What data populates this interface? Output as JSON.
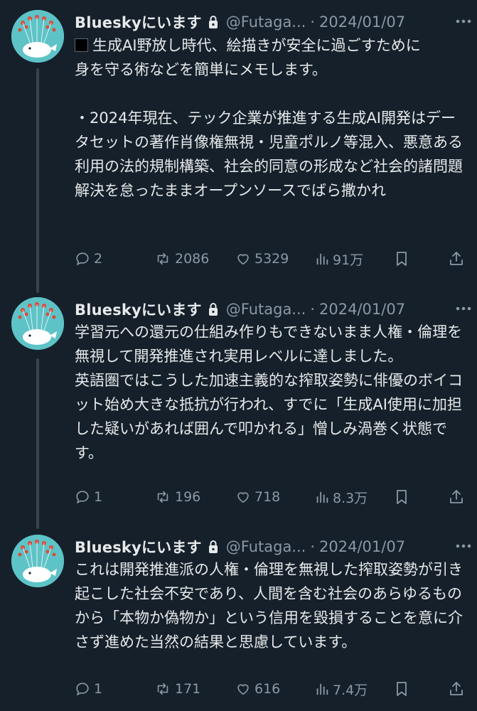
{
  "tweets": [
    {
      "display_name": "Blueskyにいます",
      "handle": "@Futaga...",
      "separator": "·",
      "date": "2024/01/07",
      "text_lead": "生成AI野放し時代、絵描きが安全に過ごすため",
      "text_rest": "に\n身を守る術などを簡単にメモします。\n\n・2024年現在、テック企業が推進する生成AI開発はデータセットの著作肖像権無視・児童ポルノ等混入、悪意ある利用の法的規制構築、社会的同意の形成など社会的諸問題解決を怠ったままオープンソースでばら撒かれ",
      "replies": "2",
      "reposts": "2086",
      "likes": "5329",
      "views": "91万"
    },
    {
      "display_name": "Blueskyにいます",
      "handle": "@Futaga...",
      "separator": "·",
      "date": "2024/01/07",
      "text": "学習元への還元の仕組み作りもできないまま人権・倫理を無視して開発推進され実用レベルに達しました。\n英語圏ではこうした加速主義的な搾取姿勢に俳優のボイコット始め大きな抵抗が行われ、すでに「生成AI使用に加担した疑いがあれば囲んで叩かれる」憎しみ渦巻く状態です。",
      "replies": "1",
      "reposts": "196",
      "likes": "718",
      "views": "8.3万"
    },
    {
      "display_name": "Blueskyにいます",
      "handle": "@Futaga...",
      "separator": "·",
      "date": "2024/01/07",
      "text": "これは開発推進派の人権・倫理を無視した搾取姿勢が引き起こした社会不安であり、人間を含む社会のあらゆるものから「本物か偽物か」という信用を毀損することを意に介さず進めた当然の結果と思慮しています。",
      "replies": "1",
      "reposts": "171",
      "likes": "616",
      "views": "7.4万"
    }
  ],
  "icons": {
    "verified_lock": "lock-icon",
    "more": "more-icon",
    "reply": "reply-icon",
    "repost": "repost-icon",
    "like": "like-icon",
    "views": "views-icon",
    "bookmark": "bookmark-icon",
    "share": "share-icon"
  },
  "colors": {
    "background": "#15202b",
    "text": "#e7e9ea",
    "secondary": "#8b98a5",
    "thread_line": "#38444d",
    "avatar_bg": "#5ec3c7"
  }
}
